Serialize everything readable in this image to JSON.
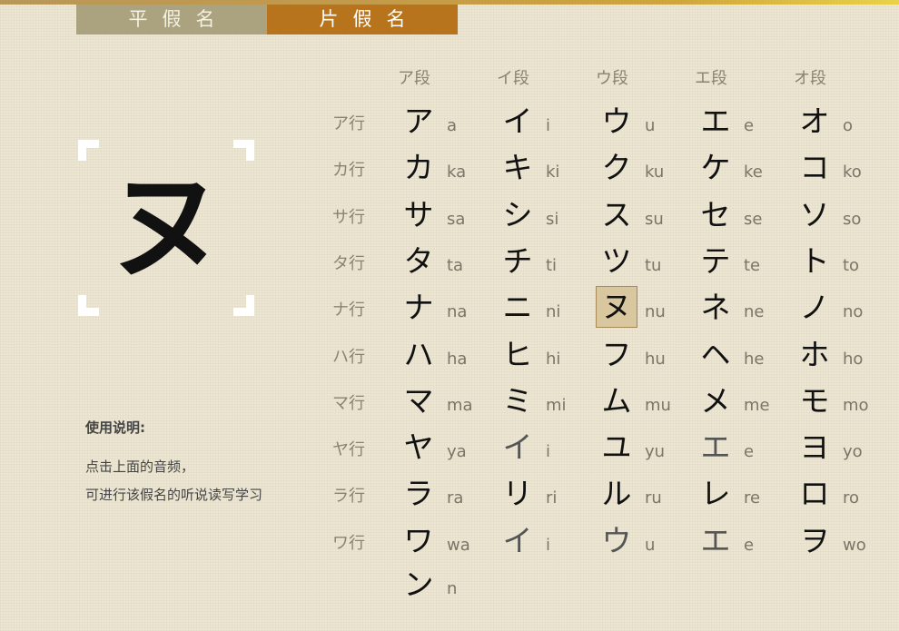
{
  "tabs": [
    {
      "label": "平假名",
      "active": false
    },
    {
      "label": "片假名",
      "active": true
    }
  ],
  "selected": {
    "kana": "ヌ",
    "romaji": "nu"
  },
  "usage": {
    "title": "使用说明:",
    "line1": "点击上面的音频，",
    "line2": "可进行该假名的听说读写学习"
  },
  "table": {
    "columns": [
      "ア段",
      "イ段",
      "ウ段",
      "エ段",
      "オ段"
    ],
    "rows": [
      {
        "label": "ア行",
        "cells": [
          {
            "kana": "ア",
            "romaji": "a"
          },
          {
            "kana": "イ",
            "romaji": "i"
          },
          {
            "kana": "ウ",
            "romaji": "u"
          },
          {
            "kana": "エ",
            "romaji": "e"
          },
          {
            "kana": "オ",
            "romaji": "o"
          }
        ]
      },
      {
        "label": "カ行",
        "cells": [
          {
            "kana": "カ",
            "romaji": "ka"
          },
          {
            "kana": "キ",
            "romaji": "ki"
          },
          {
            "kana": "ク",
            "romaji": "ku"
          },
          {
            "kana": "ケ",
            "romaji": "ke"
          },
          {
            "kana": "コ",
            "romaji": "ko"
          }
        ]
      },
      {
        "label": "サ行",
        "cells": [
          {
            "kana": "サ",
            "romaji": "sa"
          },
          {
            "kana": "シ",
            "romaji": "si"
          },
          {
            "kana": "ス",
            "romaji": "su"
          },
          {
            "kana": "セ",
            "romaji": "se"
          },
          {
            "kana": "ソ",
            "romaji": "so"
          }
        ]
      },
      {
        "label": "タ行",
        "cells": [
          {
            "kana": "タ",
            "romaji": "ta"
          },
          {
            "kana": "チ",
            "romaji": "ti"
          },
          {
            "kana": "ツ",
            "romaji": "tu"
          },
          {
            "kana": "テ",
            "romaji": "te"
          },
          {
            "kana": "ト",
            "romaji": "to"
          }
        ]
      },
      {
        "label": "ナ行",
        "cells": [
          {
            "kana": "ナ",
            "romaji": "na"
          },
          {
            "kana": "ニ",
            "romaji": "ni"
          },
          {
            "kana": "ヌ",
            "romaji": "nu",
            "selected": true
          },
          {
            "kana": "ネ",
            "romaji": "ne"
          },
          {
            "kana": "ノ",
            "romaji": "no"
          }
        ]
      },
      {
        "label": "ハ行",
        "cells": [
          {
            "kana": "ハ",
            "romaji": "ha"
          },
          {
            "kana": "ヒ",
            "romaji": "hi"
          },
          {
            "kana": "フ",
            "romaji": "hu"
          },
          {
            "kana": "ヘ",
            "romaji": "he"
          },
          {
            "kana": "ホ",
            "romaji": "ho"
          }
        ]
      },
      {
        "label": "マ行",
        "cells": [
          {
            "kana": "マ",
            "romaji": "ma"
          },
          {
            "kana": "ミ",
            "romaji": "mi"
          },
          {
            "kana": "ム",
            "romaji": "mu"
          },
          {
            "kana": "メ",
            "romaji": "me"
          },
          {
            "kana": "モ",
            "romaji": "mo"
          }
        ]
      },
      {
        "label": "ヤ行",
        "cells": [
          {
            "kana": "ヤ",
            "romaji": "ya"
          },
          {
            "kana": "イ",
            "romaji": "i",
            "dim": true
          },
          {
            "kana": "ユ",
            "romaji": "yu"
          },
          {
            "kana": "エ",
            "romaji": "e",
            "dim": true
          },
          {
            "kana": "ヨ",
            "romaji": "yo"
          }
        ]
      },
      {
        "label": "ラ行",
        "cells": [
          {
            "kana": "ラ",
            "romaji": "ra"
          },
          {
            "kana": "リ",
            "romaji": "ri"
          },
          {
            "kana": "ル",
            "romaji": "ru"
          },
          {
            "kana": "レ",
            "romaji": "re"
          },
          {
            "kana": "ロ",
            "romaji": "ro"
          }
        ]
      },
      {
        "label": "ワ行",
        "cells": [
          {
            "kana": "ワ",
            "romaji": "wa"
          },
          {
            "kana": "イ",
            "romaji": "i",
            "dim": true
          },
          {
            "kana": "ウ",
            "romaji": "u",
            "dim": true
          },
          {
            "kana": "エ",
            "romaji": "e",
            "dim": true
          },
          {
            "kana": "ヲ",
            "romaji": "wo"
          }
        ]
      }
    ],
    "extra": {
      "kana": "ン",
      "romaji": "n"
    }
  }
}
